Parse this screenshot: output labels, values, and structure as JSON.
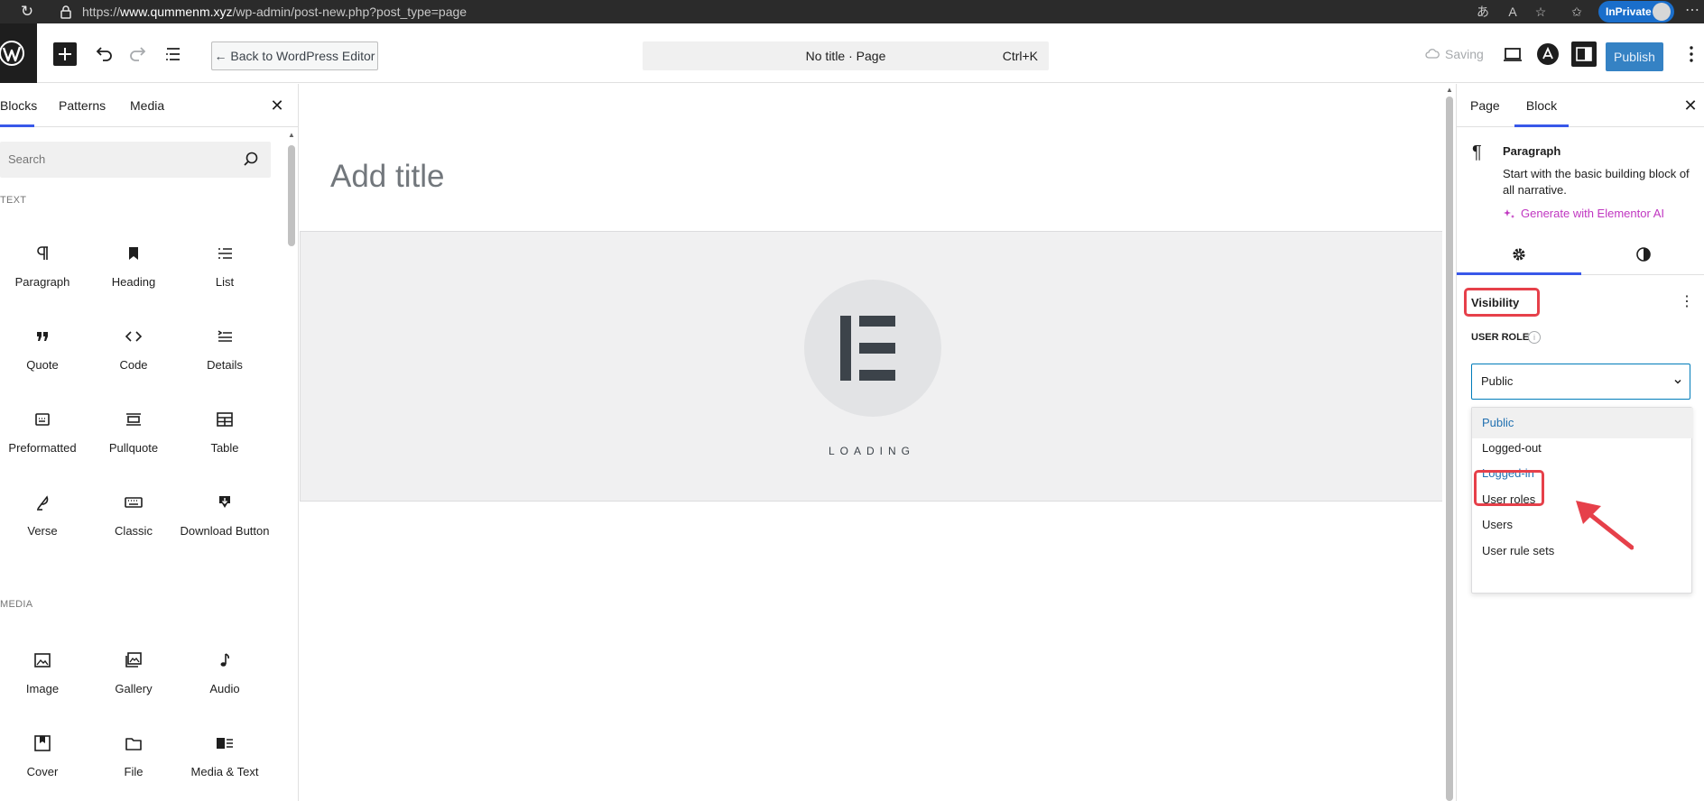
{
  "browser": {
    "url_prefix": "https://",
    "url_domain": "www.qummenm.xyz",
    "url_path": "/wp-admin/post-new.php?post_type=page",
    "inprivate_label": "InPrivate",
    "icons": [
      "reload-icon",
      "lock-icon",
      "read-aloud-icon",
      "text-size-icon",
      "favorite-icon",
      "favorites-list-icon",
      "more-icon"
    ]
  },
  "toolbar": {
    "back_label": "← Back to WordPress Editor",
    "doc_title": "No title · Page",
    "shortcut": "Ctrl+K",
    "saving_label": "Saving",
    "publish_label": "Publish"
  },
  "inserter": {
    "tabs": [
      "Blocks",
      "Patterns",
      "Media"
    ],
    "search_placeholder": "Search",
    "categories": [
      {
        "name": "TEXT",
        "blocks": [
          {
            "label": "Paragraph",
            "icon": "paragraph-icon"
          },
          {
            "label": "Heading",
            "icon": "heading-icon"
          },
          {
            "label": "List",
            "icon": "list-icon"
          },
          {
            "label": "Quote",
            "icon": "quote-icon"
          },
          {
            "label": "Code",
            "icon": "code-icon"
          },
          {
            "label": "Details",
            "icon": "details-icon"
          },
          {
            "label": "Preformatted",
            "icon": "preformatted-icon"
          },
          {
            "label": "Pullquote",
            "icon": "pullquote-icon"
          },
          {
            "label": "Table",
            "icon": "table-icon"
          },
          {
            "label": "Verse",
            "icon": "verse-icon"
          },
          {
            "label": "Classic",
            "icon": "classic-icon"
          },
          {
            "label": "Download Button",
            "icon": "download-button-icon"
          }
        ]
      },
      {
        "name": "MEDIA",
        "blocks": [
          {
            "label": "Image",
            "icon": "image-icon"
          },
          {
            "label": "Gallery",
            "icon": "gallery-icon"
          },
          {
            "label": "Audio",
            "icon": "audio-icon"
          },
          {
            "label": "Cover",
            "icon": "cover-icon"
          },
          {
            "label": "File",
            "icon": "file-icon"
          },
          {
            "label": "Media & Text",
            "icon": "media-text-icon"
          }
        ]
      }
    ]
  },
  "canvas": {
    "title_placeholder": "Add title",
    "loading_text": "LOADING"
  },
  "sidebar": {
    "tabs": [
      "Page",
      "Block"
    ],
    "active_tab": "Block",
    "block": {
      "name": "Paragraph",
      "description": "Start with the basic building block of all narrative.",
      "ai_link": "Generate with Elementor AI"
    },
    "section_title": "Visibility",
    "user_role_label": "USER ROLE",
    "selected_role": "Public",
    "role_options": [
      "Public",
      "Logged-out",
      "Logged-in",
      "User roles",
      "Users",
      "User rule sets"
    ],
    "highlighted_option": "Logged-in"
  },
  "colors": {
    "accent": "#3858e9",
    "publish": "#3582c4",
    "annotation": "#e6404a",
    "ai_link": "#c036c1"
  }
}
